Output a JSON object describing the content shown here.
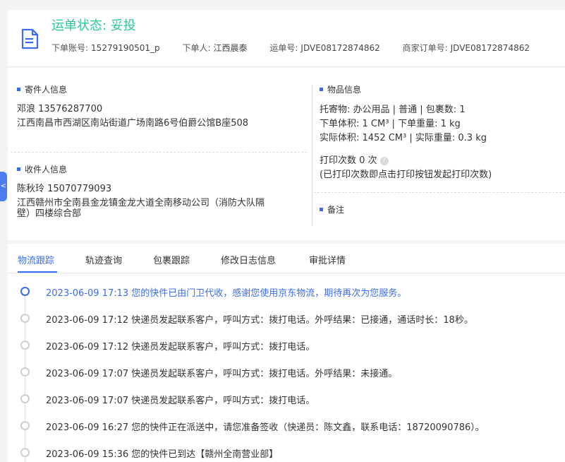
{
  "header": {
    "status_label": "运单状态: 妥投",
    "fields": [
      {
        "key": "下单账号:",
        "value": "15279190501_p"
      },
      {
        "key": "下单人:",
        "value": "江西晨泰"
      },
      {
        "key": "运单号:",
        "value": "JDVE08172874862"
      },
      {
        "key": "商家订单号:",
        "value": "JDVE08172874862"
      }
    ]
  },
  "sender": {
    "title": "寄件人信息",
    "name_phone": "邓浪   13576287700",
    "address": "江西南昌市西湖区南站街道广场南路6号伯爵公馆B座508"
  },
  "receiver": {
    "title": "收件人信息",
    "name_phone": "陈秋玲   15070779093",
    "address_line1": "江西赣州市全南县金龙镇金龙大道全南移动公司（消防大队隔",
    "address_line2": "壁）四楼综合部"
  },
  "goods": {
    "title": "物品信息",
    "line1": "托寄物:  办公用品 | 普通  |  包裹数:  1",
    "line2": "下单体积:    1 CM³  |  下单重量:    1 kg",
    "line3": "实际体积:    1452 CM³  |  实际重量:   0.3 kg",
    "print_count": "打印次数    0 次",
    "print_hint": "(已打印次数即点击打印按钮发起打印次数)"
  },
  "remark": {
    "title": "备注"
  },
  "sidetab": {
    "label": "<"
  },
  "tabs": [
    "物流跟踪",
    "轨迹查询",
    "包裹跟踪",
    "修改日志信息",
    "审批详情"
  ],
  "events": [
    "2023-06-09 17:13 您的快件已由门卫代收，感谢您使用京东物流，期待再次为您服务。",
    "2023-06-09 17:12 快递员发起联系客户，呼叫方式：拨打电话。外呼结果：已接通，通话时长：18秒。",
    "2023-06-09 17:12 快递员发起联系客户，呼叫方式：拨打电话。",
    "2023-06-09 17:07 快递员发起联系客户，呼叫方式：拨打电话。外呼结果：未接通。",
    "2023-06-09 17:07 快递员发起联系客户，呼叫方式：拨打电话。",
    "2023-06-09 16:27 您的快件正在派送中，请您准备签收（快递员：陈文鑫，联系电话：18720090786）。",
    "2023-06-09 15:36 您的快件已到达【赣州全南营业部】"
  ],
  "colors": {
    "status": "#2bc79a",
    "accent": "#3a6cf1"
  }
}
